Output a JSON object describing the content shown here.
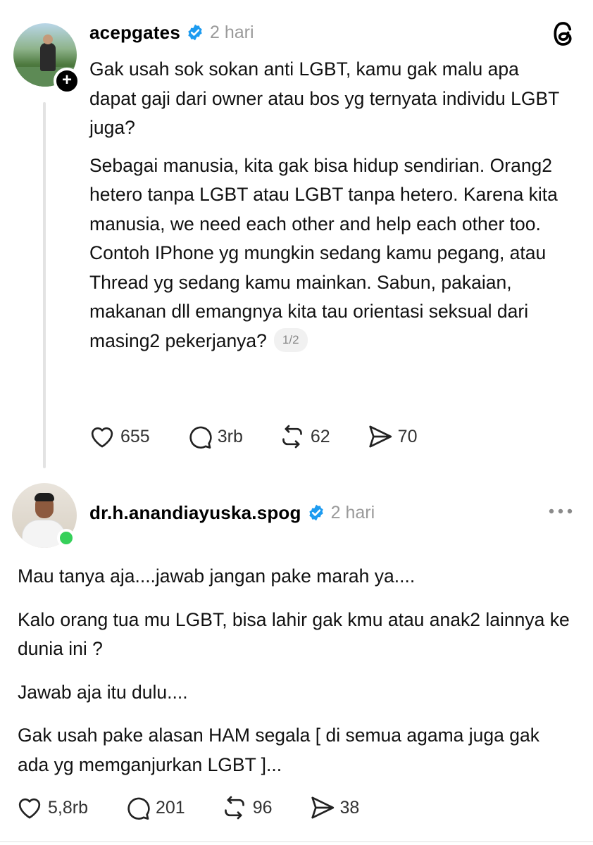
{
  "post1": {
    "username": "acepgates",
    "time": "2 hari",
    "paragraphs": [
      "Gak usah sok sokan anti LGBT, kamu gak malu apa dapat gaji dari owner atau bos yg ternyata individu LGBT juga?",
      "Sebagai manusia, kita gak bisa hidup sendirian. Orang2 hetero tanpa LGBT atau LGBT tanpa hetero. Karena kita manusia, we need each other and help each other too. Contoh IPhone yg mungkin sedang kamu pegang, atau Thread yg sedang kamu mainkan. Sabun, pakaian, makanan dll emangnya kita tau orientasi seksual dari masing2 pekerjanya?"
    ],
    "page_indicator": "1/2",
    "likes": "655",
    "replies": "3rb",
    "reposts": "62",
    "shares": "70"
  },
  "post2": {
    "username": "dr.h.anandiayuska.spog",
    "time": "2 hari",
    "paragraphs": [
      "Mau tanya aja....jawab jangan pake marah ya....",
      "Kalo orang tua mu LGBT, bisa lahir gak kmu atau anak2 lainnya ke dunia ini ?",
      "Jawab aja itu dulu....",
      "Gak usah pake alasan HAM segala [ di semua agama juga gak ada yg memganjurkan LGBT ]..."
    ],
    "likes": "5,8rb",
    "replies": "201",
    "reposts": "96",
    "shares": "38"
  },
  "colors": {
    "verified": "#1d9bf0",
    "online": "#36d05a",
    "muted_text": "#9a9a9a",
    "thread_line": "#e3e3e3"
  },
  "icons": [
    "plus-icon",
    "verified-icon",
    "threads-logo-icon",
    "heart-icon",
    "comment-icon",
    "repost-icon",
    "share-icon",
    "more-icon"
  ]
}
